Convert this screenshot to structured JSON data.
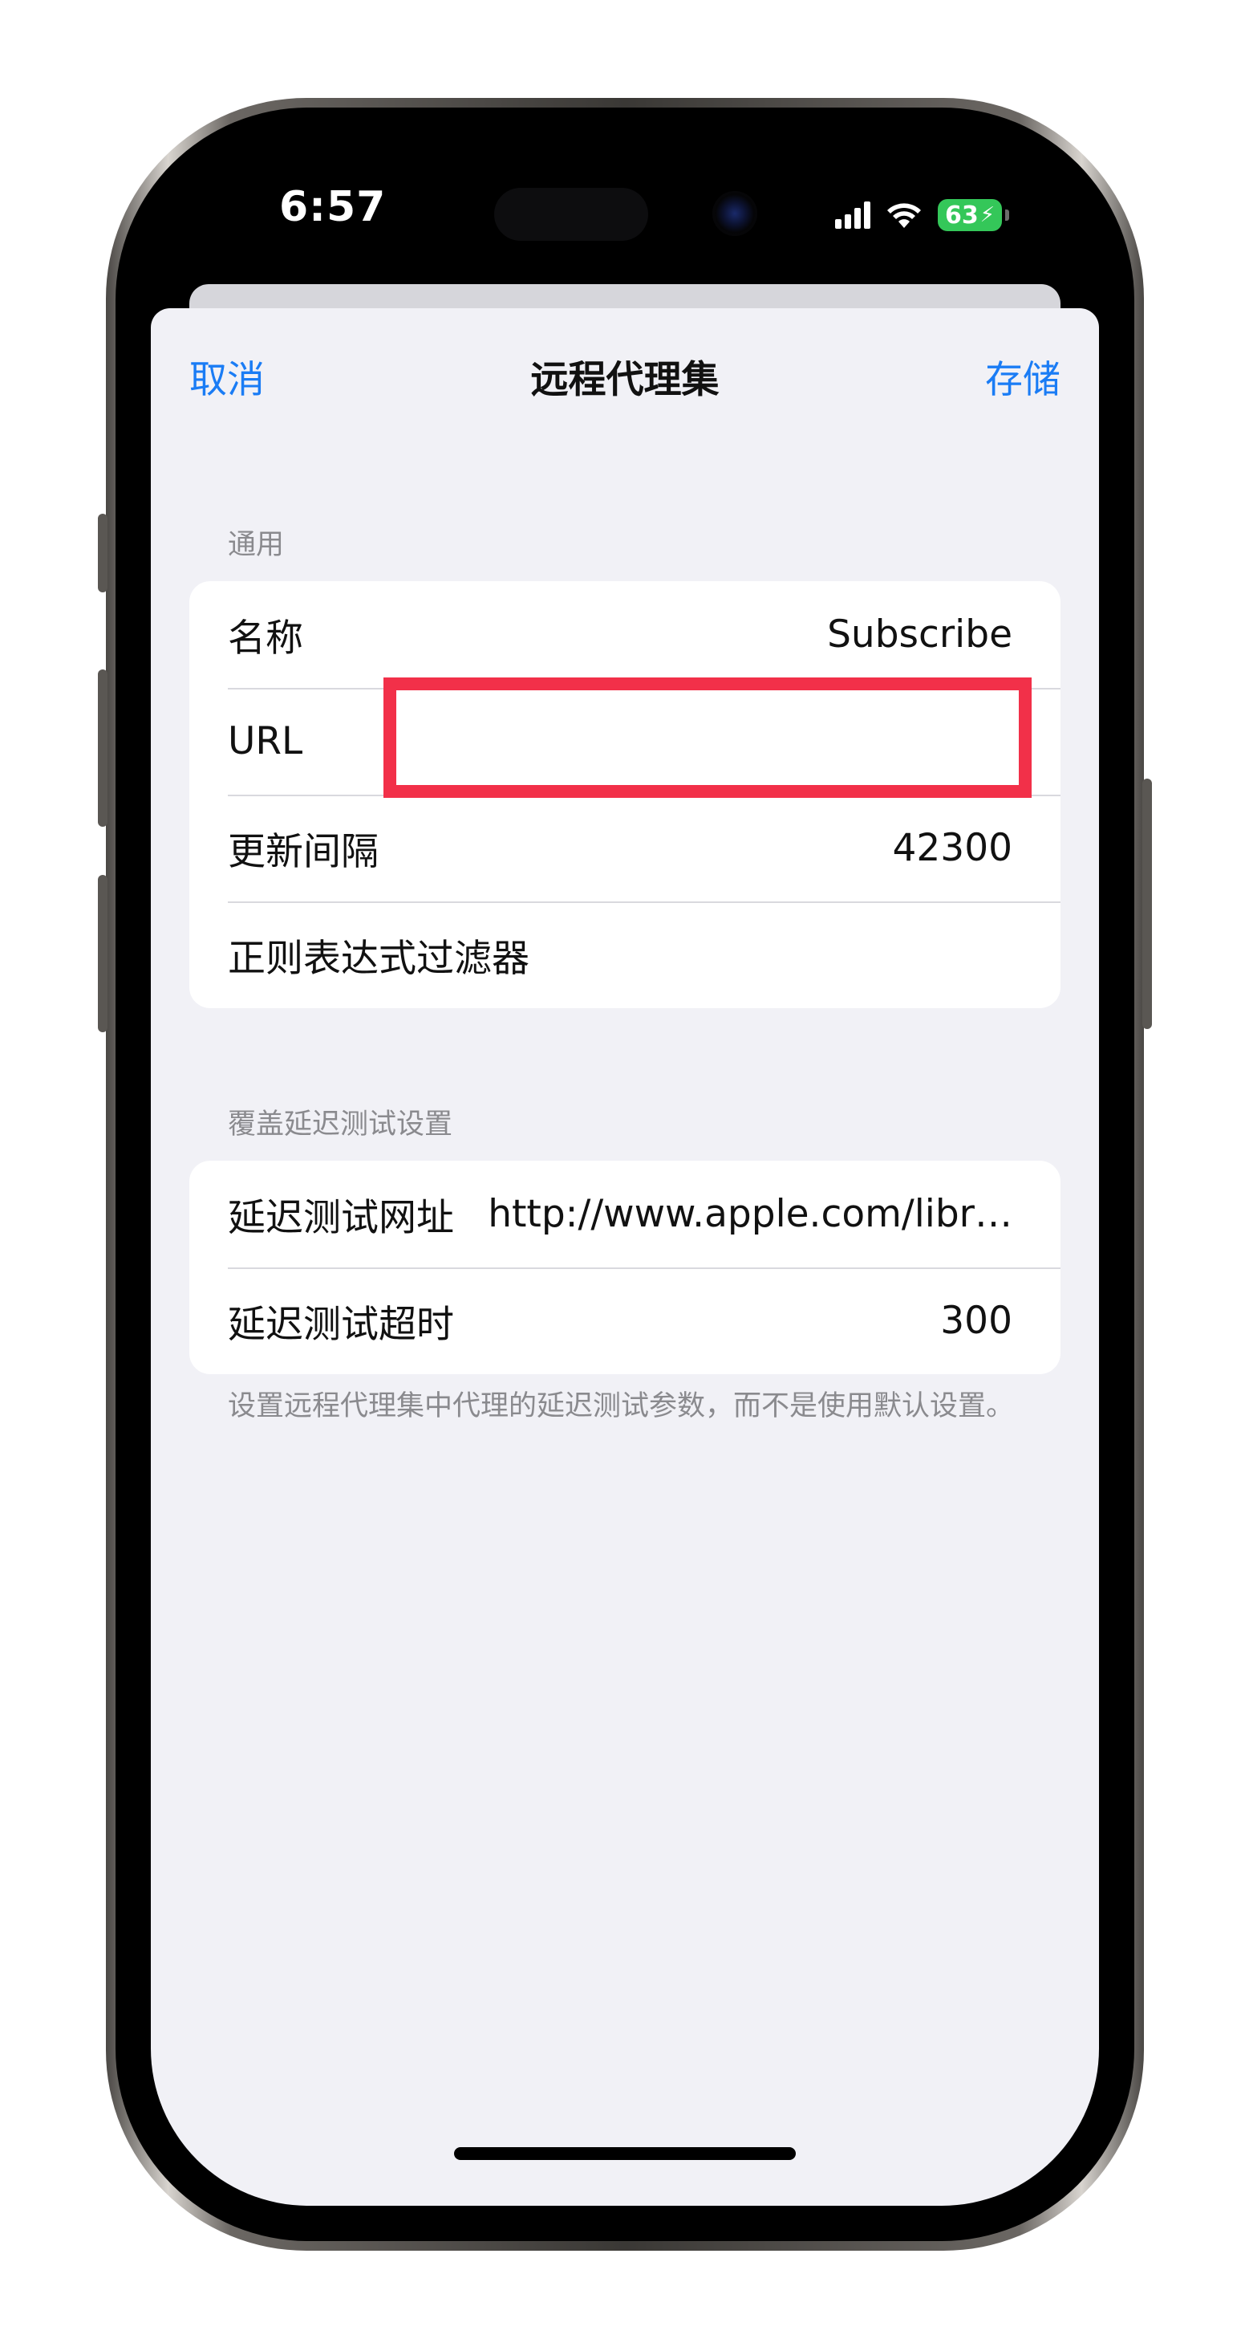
{
  "status_bar": {
    "time": "6:57",
    "battery_level": "63",
    "icons": [
      "signal-icon",
      "wifi-icon",
      "battery-charging-icon"
    ],
    "battery_color": "#34c759"
  },
  "nav": {
    "cancel_label": "取消",
    "title": "远程代理集",
    "save_label": "存储",
    "accent_color": "#1a7cf5"
  },
  "general": {
    "header": "通用",
    "rows": [
      {
        "label": "名称",
        "value": "Subscribe"
      },
      {
        "label": "URL",
        "value": ""
      },
      {
        "label": "更新间隔",
        "value": "42300"
      },
      {
        "label": "正则表达式过滤器",
        "value": ""
      }
    ]
  },
  "latency": {
    "header": "覆盖延迟测试设置",
    "rows": [
      {
        "label": "延迟测试网址",
        "value": "http://www.apple.com/libr…"
      },
      {
        "label": "延迟测试超时",
        "value": "300"
      }
    ],
    "footer": "设置远程代理集中代理的延迟测试参数，而不是使用默认设置。"
  },
  "annotation": {
    "highlight_color": "#f23049"
  }
}
